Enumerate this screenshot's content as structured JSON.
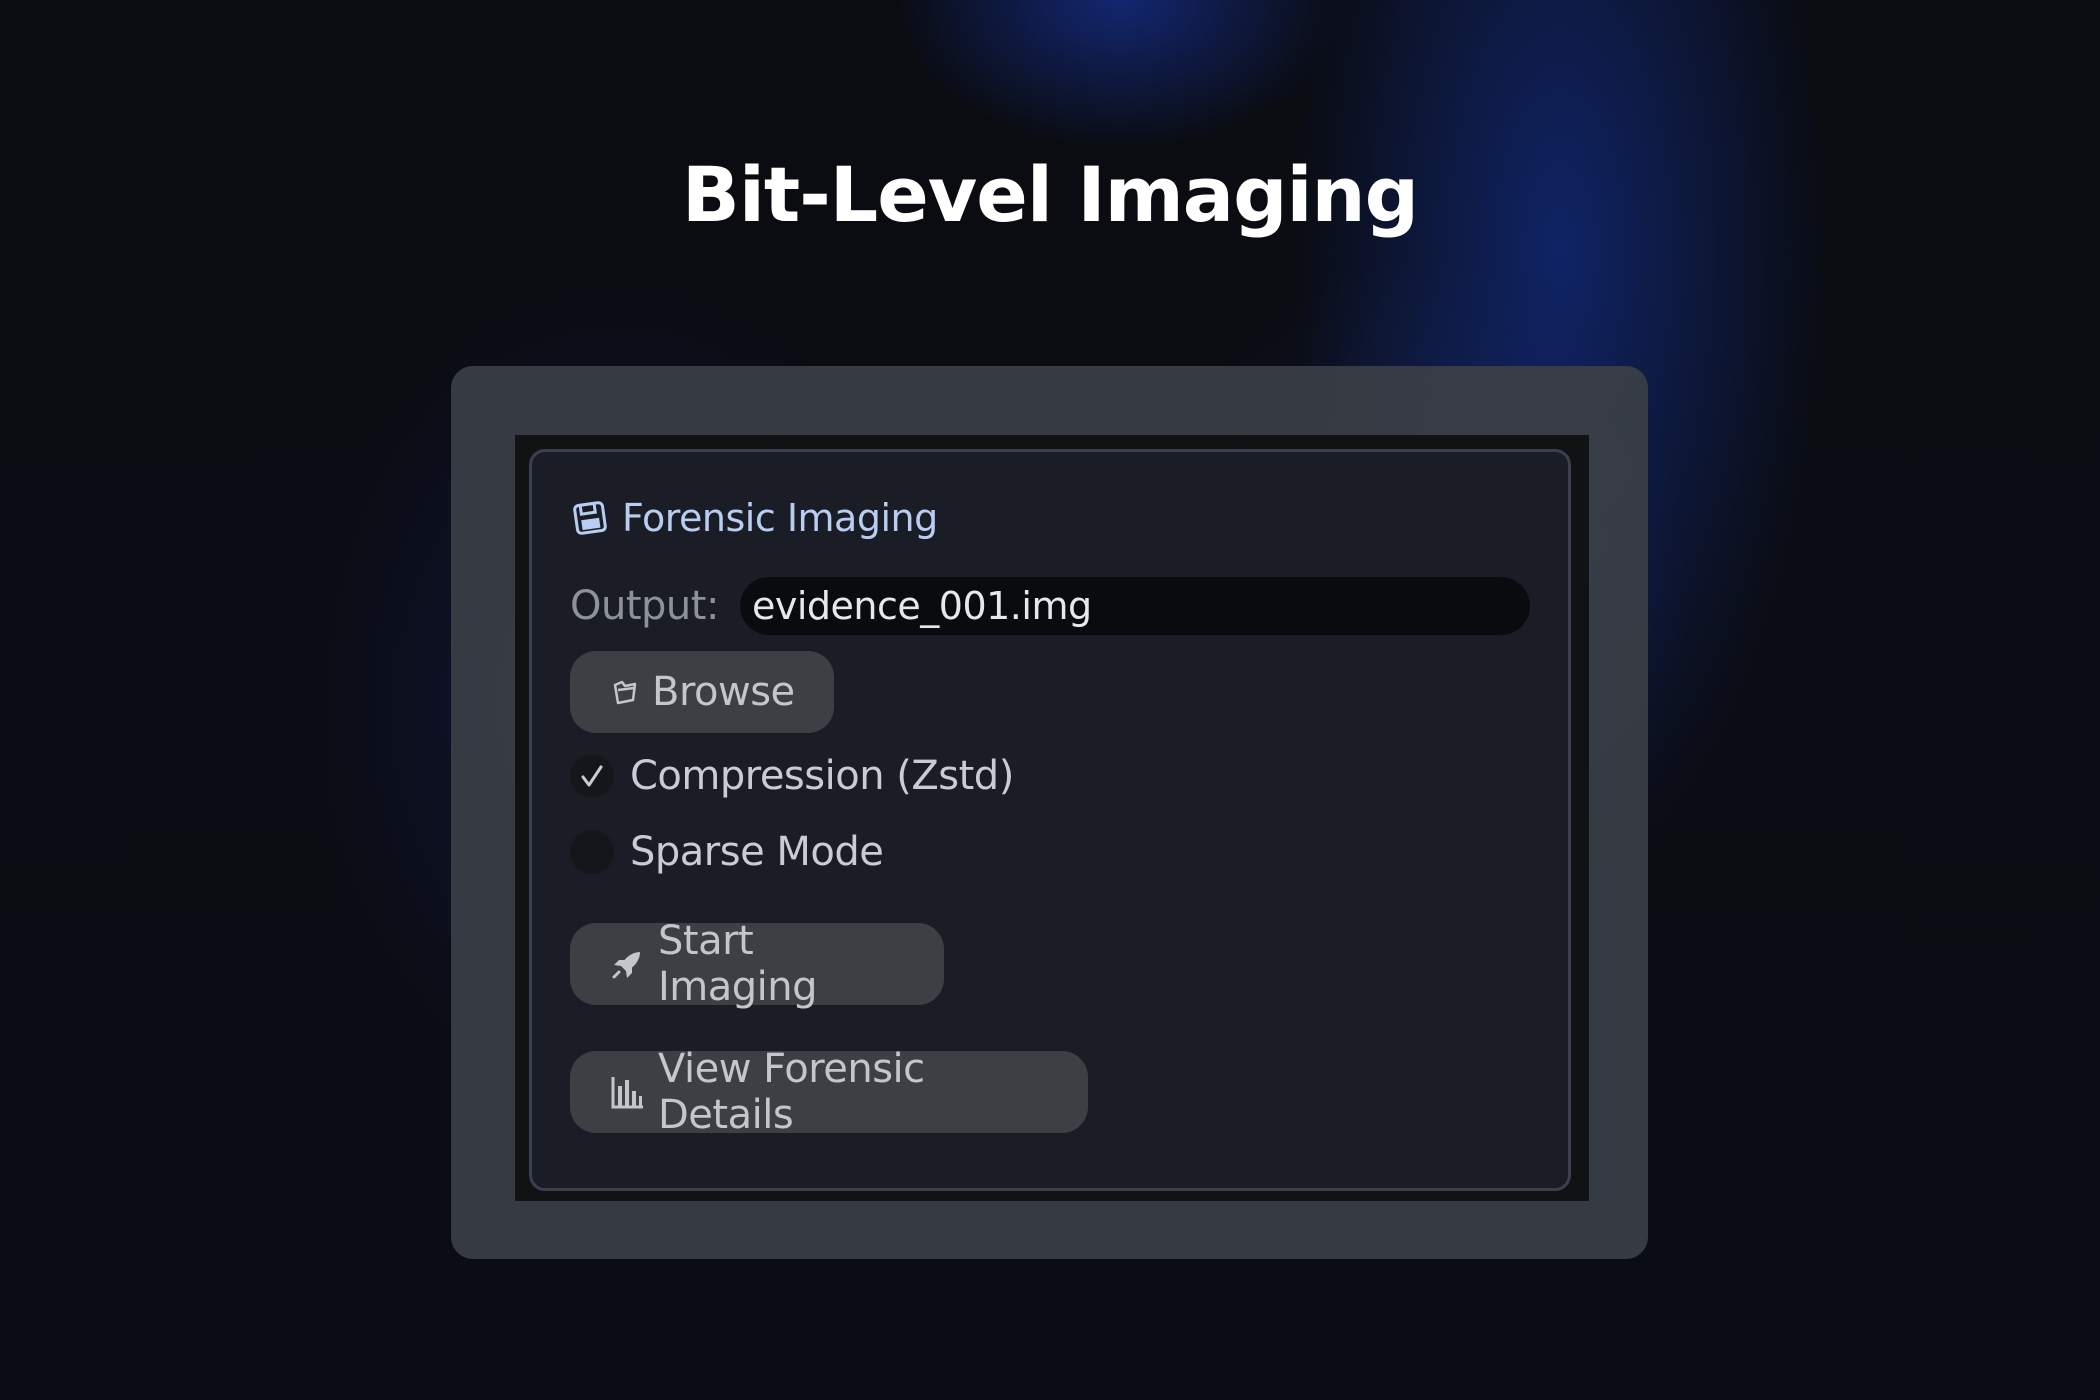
{
  "page": {
    "title": "Bit-Level Imaging"
  },
  "panel": {
    "title": "Forensic Imaging",
    "header_icon": "floppy-disk-icon",
    "output": {
      "label": "Output:",
      "value": "evidence_001.img"
    },
    "browse_button": {
      "label": "Browse",
      "icon": "folder-icon"
    },
    "options": [
      {
        "label": "Compression (Zstd)",
        "checked": true
      },
      {
        "label": "Sparse Mode",
        "checked": false
      }
    ],
    "start_button": {
      "label": "Start Imaging",
      "icon": "rocket-icon"
    },
    "details_button": {
      "label": "View Forensic Details",
      "icon": "bar-chart-icon"
    }
  },
  "colors": {
    "background": "#0b0d14",
    "frame": "#3a3e46",
    "panel": "#1a1d26",
    "panel_border": "#3a4050",
    "title_accent": "#b9cdf2",
    "button": "#3d3f44"
  }
}
